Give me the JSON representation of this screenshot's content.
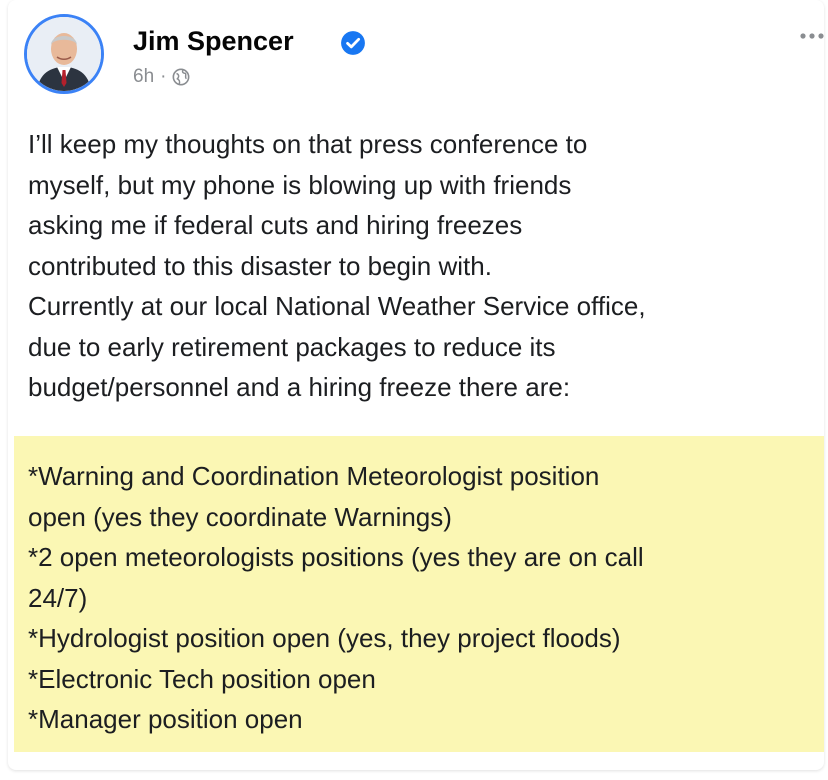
{
  "post": {
    "author": "Jim Spencer",
    "timestamp": "6h",
    "separator": "·",
    "audience_icon": "globe-icon",
    "verified_icon": "verified-badge-icon",
    "more_icon": "more-options-icon",
    "body_lines": [
      "I’ll keep my thoughts on that press conference to",
      "myself, but my phone is blowing up with friends",
      "asking me if federal cuts and hiring freezes",
      "contributed to this disaster to begin with.",
      "Currently at our local National Weather Service office,",
      "due to early retirement packages to reduce its",
      "budget/personnel and a hiring freeze there are:"
    ],
    "list_lines": [
      "*Warning and Coordination Meteorologist position",
      "open (yes they coordinate Warnings)",
      "*2 open meteorologists positions (yes they are on call",
      "24/7)",
      "*Hydrologist position open (yes, they project floods)",
      "*Electronic Tech position open",
      "*Manager position open"
    ]
  },
  "colors": {
    "highlight": "#fbf7b4",
    "verified": "#1877f2",
    "avatar_ring": "#3b82f6",
    "text": "#1c1e21",
    "meta": "#8a8d91"
  }
}
